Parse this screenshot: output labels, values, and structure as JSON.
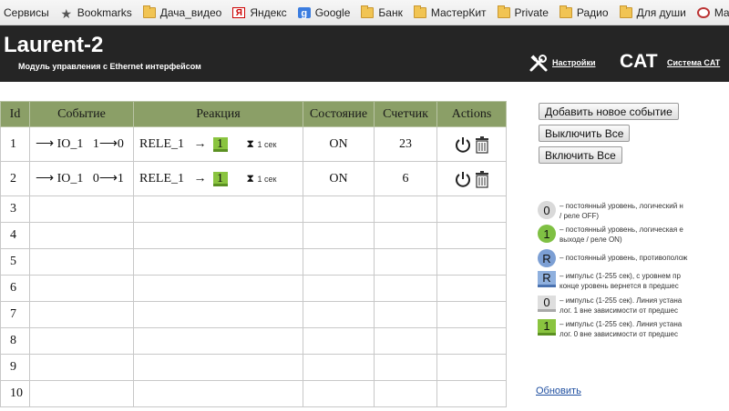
{
  "bookmarks": [
    {
      "label": "Сервисы",
      "icon": "apps-icon"
    },
    {
      "label": "Bookmarks",
      "icon": "star-icon"
    },
    {
      "label": "Дача_видео",
      "icon": "folder-icon"
    },
    {
      "label": "Яндекс",
      "icon": "yandex-icon"
    },
    {
      "label": "Google",
      "icon": "google-icon"
    },
    {
      "label": "Банк",
      "icon": "folder-icon"
    },
    {
      "label": "МастерКит",
      "icon": "folder-icon"
    },
    {
      "label": "Private",
      "icon": "folder-icon"
    },
    {
      "label": "Радио",
      "icon": "folder-icon"
    },
    {
      "label": "Для души",
      "icon": "folder-icon"
    },
    {
      "label": "Main Me",
      "icon": "site-icon"
    }
  ],
  "header": {
    "logo": "Laurent-2",
    "subtitle": "Модуль управления с Ethernet интерфейсом",
    "settings_label": "Настройки",
    "cat_label": "CAT",
    "cat_link": "Система CAT"
  },
  "table": {
    "headers": [
      "Id",
      "Событие",
      "Реакция",
      "Состояние",
      "Счетчик",
      "Actions"
    ],
    "events": [
      {
        "id": "1",
        "event_io": "IO_1",
        "event_trans": "1⟶0",
        "relay": "RELE_1",
        "arrow": "→",
        "level": "1",
        "duration": "1 сек",
        "state": "ON",
        "counter": "23"
      },
      {
        "id": "2",
        "event_io": "IO_1",
        "event_trans": "0⟶1",
        "relay": "RELE_1",
        "arrow": "→",
        "level": "1",
        "duration": "1 сек",
        "state": "ON",
        "counter": "6"
      }
    ],
    "empty_ids": [
      "3",
      "4",
      "5",
      "6",
      "7",
      "8",
      "9",
      "10"
    ]
  },
  "buttons": {
    "add": "Добавить новое событие",
    "off_all": "Выключить Все",
    "on_all": "Включить Все"
  },
  "legend": [
    {
      "symbol": "0",
      "lines": [
        "постоянный уровень, логический н",
        "/ реле OFF)"
      ]
    },
    {
      "symbol": "1",
      "lines": [
        "постоянный уровень, логическая е",
        "выходе / реле ON)"
      ]
    },
    {
      "symbol": "R",
      "lines": [
        "постоянный уровень, противополож"
      ]
    },
    {
      "symbol": "R",
      "lines": [
        "импульс (1-255 сек), с уровнем пр",
        "конце уровень вернется в предшес"
      ]
    },
    {
      "symbol": "0",
      "lines": [
        "импульс (1-255 сек). Линия устана",
        "лог. 1 вне зависимости от предшес"
      ]
    },
    {
      "symbol": "1",
      "lines": [
        "импульс (1-255 сек). Линия устана",
        "лог. 0 вне зависимости от предшес"
      ]
    }
  ],
  "refresh_label": "Обновить"
}
